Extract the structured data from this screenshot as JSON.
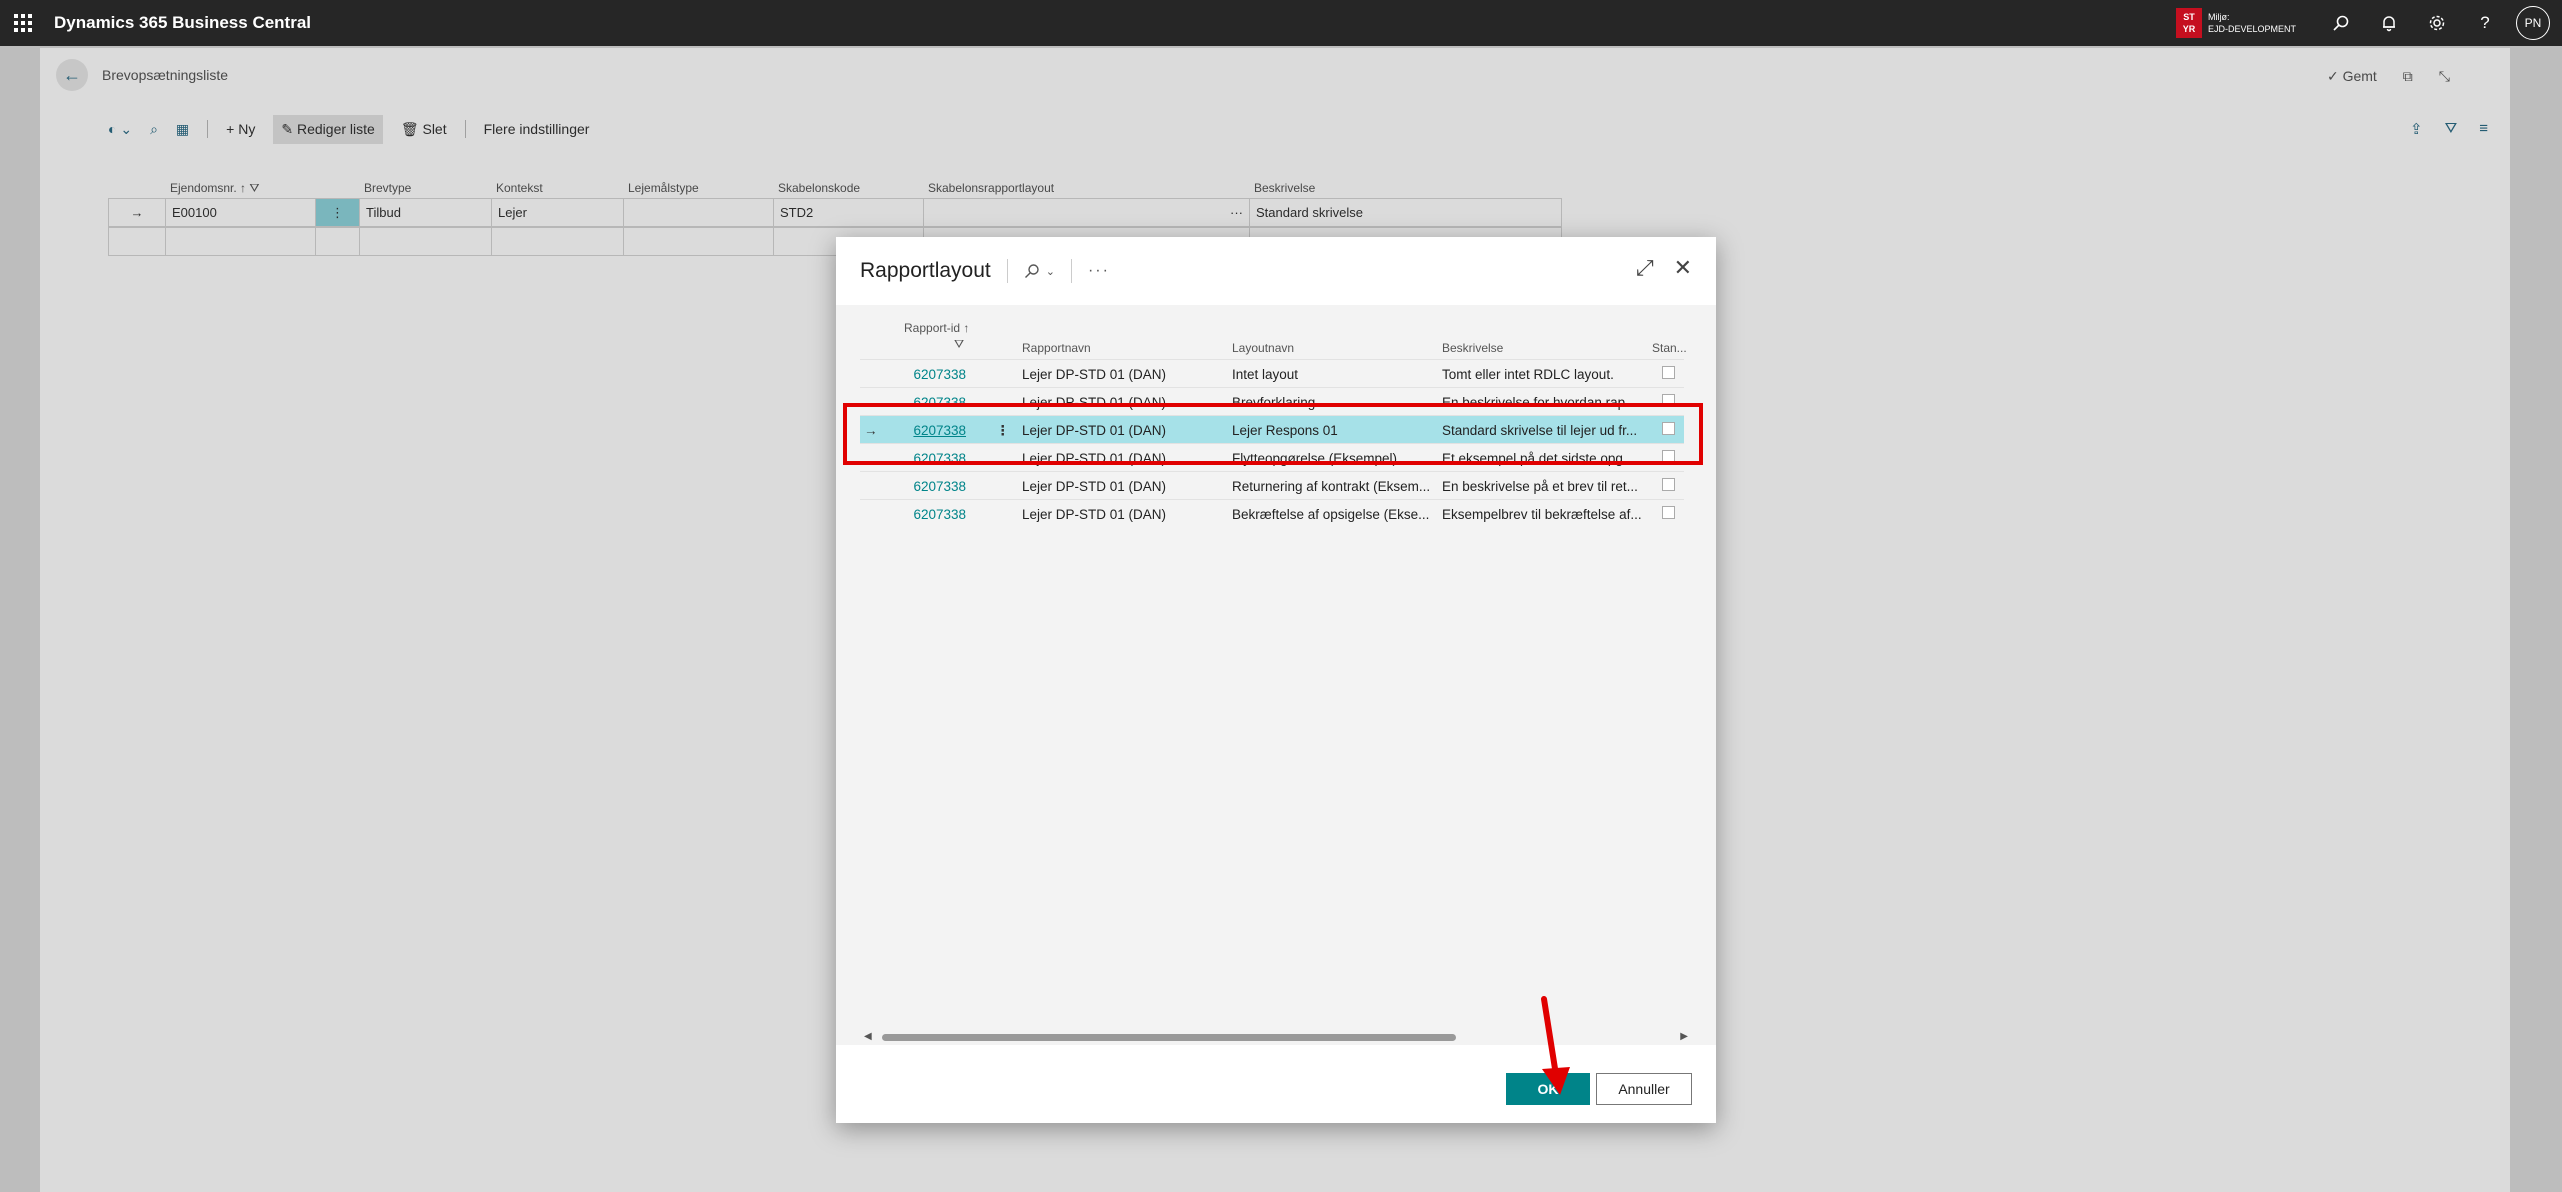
{
  "appbar": {
    "title": "Dynamics 365 Business Central",
    "env_badge": [
      "ST",
      "YR"
    ],
    "env_label": "Miljø:",
    "env_name": "EJD-DEVELOPMENT",
    "user_initials": "PN",
    "icons": [
      "waffle-icon",
      "search-icon",
      "bell-icon",
      "gear-icon",
      "help-icon"
    ]
  },
  "page": {
    "caption": "Brevopsætningsliste",
    "saved_label": "Gemt",
    "actions": {
      "new": "Ny",
      "edit_list": "Rediger liste",
      "delete": "Slet",
      "more": "Flere indstillinger"
    },
    "columns": [
      "Ejendomsnr.",
      "Brevtype",
      "Kontekst",
      "Lejemålstype",
      "Skabelonskode",
      "Skabelonsrapportlayout",
      "Beskrivelse"
    ],
    "rows": [
      {
        "ejendomsnr": "E00100",
        "brevtype": "Tilbud",
        "kontekst": "Lejer",
        "lejemaalstype": "",
        "skabelonskode": "STD2",
        "layout": "",
        "beskrivelse": "Standard skrivelse"
      }
    ]
  },
  "dialog": {
    "title": "Rapportlayout",
    "columns": {
      "id": "Rapport-id",
      "name": "Rapportnavn",
      "layout": "Layoutnavn",
      "desc": "Beskrivelse",
      "std": "Stan..."
    },
    "rows": [
      {
        "id": "6207338",
        "name": "Lejer DP-STD 01 (DAN)",
        "layout": "Intet layout",
        "desc": "Tomt eller intet RDLC layout.",
        "selected": false
      },
      {
        "id": "6207338",
        "name": "Lejer DP-STD 01 (DAN)",
        "layout": "Brevforklaring",
        "desc": "En beskrivelse for hvordan rap...",
        "selected": false
      },
      {
        "id": "6207338",
        "name": "Lejer DP-STD 01 (DAN)",
        "layout": "Lejer Respons 01",
        "desc": "Standard skrivelse til lejer ud fr...",
        "selected": true
      },
      {
        "id": "6207338",
        "name": "Lejer DP-STD 01 (DAN)",
        "layout": "Flytteopgørelse (Eksempel)",
        "desc": "Et eksempel på det sidste opg...",
        "selected": false
      },
      {
        "id": "6207338",
        "name": "Lejer DP-STD 01 (DAN)",
        "layout": "Returnering af kontrakt (Eksem...",
        "desc": "En beskrivelse på et brev til ret...",
        "selected": false
      },
      {
        "id": "6207338",
        "name": "Lejer DP-STD 01 (DAN)",
        "layout": "Bekræftelse af opsigelse (Ekse...",
        "desc": "Eksempelbrev til bekræftelse af...",
        "selected": false
      }
    ],
    "ok_label": "OK",
    "cancel_label": "Annuller"
  },
  "annotation_color": "#e00000",
  "accent_color": "#008489"
}
